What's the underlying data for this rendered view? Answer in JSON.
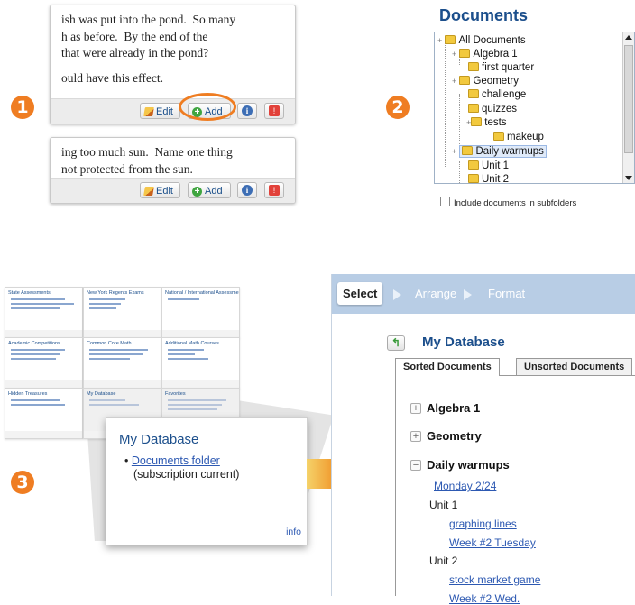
{
  "steps": [
    "1",
    "2",
    "3"
  ],
  "question_cards": [
    {
      "lines": [
        "ish was put into the pond.  So many",
        "h as before.  By the end of the",
        "that were already in the pond?",
        "",
        "ould have this effect."
      ]
    },
    {
      "lines": [
        "ing too much sun.  Name one thing",
        "not protected from the sun."
      ]
    }
  ],
  "card_toolbar": {
    "edit_label": "Edit",
    "add_label": "Add",
    "info_glyph": "i",
    "flag_glyph": "!"
  },
  "documents_panel": {
    "title": "Documents",
    "tree": [
      {
        "label": "All Documents",
        "level": 0,
        "expander": "+"
      },
      {
        "label": "Algebra 1",
        "level": 1,
        "expander": "+"
      },
      {
        "label": "first quarter",
        "level": 2
      },
      {
        "label": "Geometry",
        "level": 1,
        "expander": "+"
      },
      {
        "label": "challenge",
        "level": 2
      },
      {
        "label": "quizzes",
        "level": 2
      },
      {
        "label": "tests",
        "level": 2,
        "expander": "+"
      },
      {
        "label": "makeup",
        "level": 3
      },
      {
        "label": "Daily warmups",
        "level": 1,
        "expander": "+",
        "selected": true
      },
      {
        "label": "Unit 1",
        "level": 2
      },
      {
        "label": "Unit 2",
        "level": 2
      }
    ],
    "include_subfolders_label": "Include documents in subfolders"
  },
  "dashboard_tiles": [
    {
      "title": "State Assessments"
    },
    {
      "title": "New York Regents Exams"
    },
    {
      "title": "National / International Assessments"
    },
    {
      "title": "Academic Competitions"
    },
    {
      "title": "Common Core Math"
    },
    {
      "title": "Additional Math Courses"
    },
    {
      "title": "Hidden Treasures"
    },
    {
      "title": "My Database"
    },
    {
      "title": "Favorites"
    }
  ],
  "magnified_widget": {
    "title": "My Database",
    "link_label": "Documents folder",
    "note": "(subscription current)",
    "info_label": "info"
  },
  "organizer": {
    "steps": [
      "Select",
      "Arrange",
      "Format"
    ],
    "active_step": "Select",
    "title": "My Database",
    "up_glyph": "↰",
    "tabs": [
      "Sorted Documents",
      "Unsorted Documents"
    ],
    "groups": [
      {
        "name": "Algebra 1",
        "toggle": "+"
      },
      {
        "name": "Geometry",
        "toggle": "+"
      },
      {
        "name": "Daily warmups",
        "toggle": "−"
      }
    ],
    "daily_warmups_items": {
      "top_link": "Monday 2/24",
      "unit1_label": "Unit 1",
      "unit1_links": [
        "graphing lines",
        "Week #2 Tuesday"
      ],
      "unit2_label": "Unit 2",
      "unit2_links": [
        "stock market game",
        "Week #2 Wed."
      ]
    }
  },
  "colors": {
    "accent_orange": "#ef7d22",
    "title_blue": "#1c4f8c",
    "link_blue": "#2d59b2",
    "header_blue": "#b8cde5"
  }
}
